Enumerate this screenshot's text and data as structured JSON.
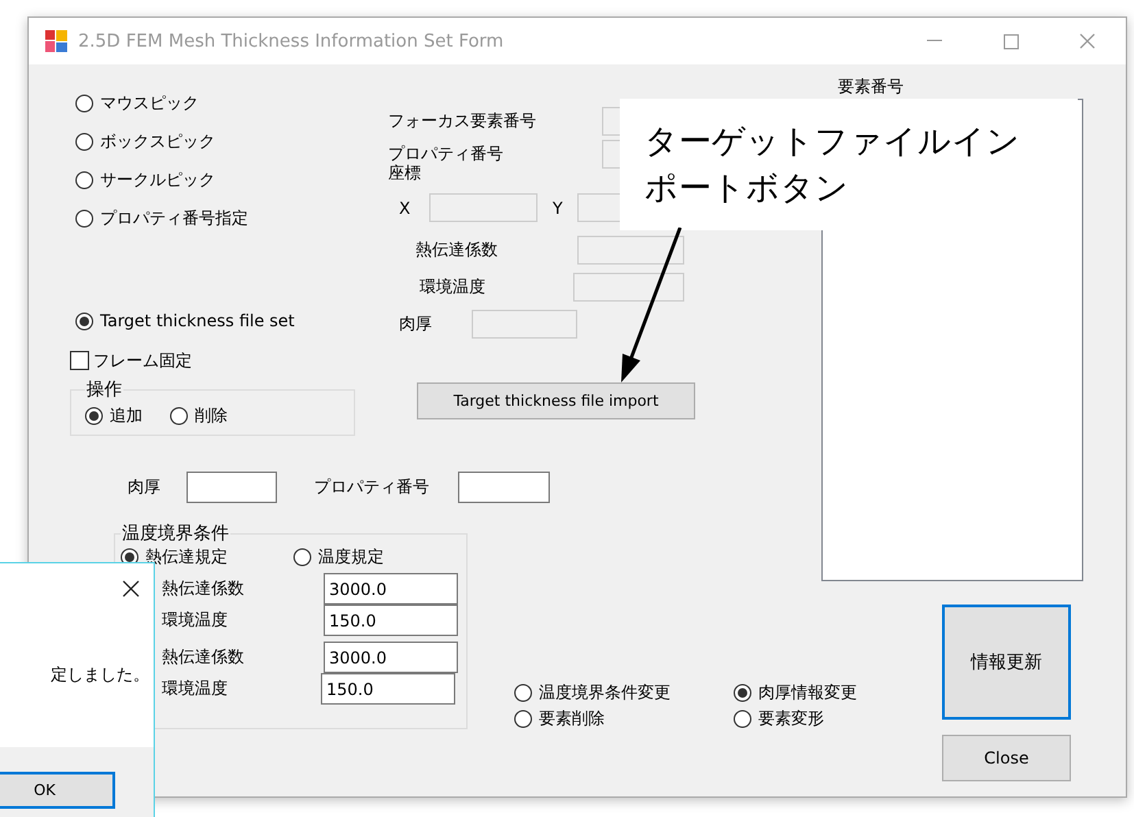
{
  "window": {
    "title": "2.5D FEM Mesh Thickness Information Set Form",
    "active": false
  },
  "pick_modes": [
    {
      "label": "マウスピック",
      "selected": false
    },
    {
      "label": "ボックスピック",
      "selected": false
    },
    {
      "label": "サークルピック",
      "selected": false
    },
    {
      "label": "プロパティ番号指定",
      "selected": false
    },
    {
      "label": "Target thickness file set",
      "selected": true
    }
  ],
  "frame_lock": {
    "label": "フレーム固定",
    "checked": false
  },
  "operation": {
    "title": "操作",
    "options": [
      {
        "label": "追加",
        "selected": true
      },
      {
        "label": "削除",
        "selected": false
      }
    ]
  },
  "info": {
    "focus_element": "フォーカス要素番号",
    "property_number": "プロパティ番号",
    "coordinates": "座標",
    "x_label": "X",
    "y_label": "Y",
    "heat_transfer": "熱伝達係数",
    "ambient_temp": "環境温度",
    "thickness": "肉厚"
  },
  "import_button": "Target thickness file import",
  "thickness_input": {
    "label": "肉厚"
  },
  "property_input": {
    "label": "プロパティ番号"
  },
  "temperature_bc": {
    "title": "温度境界条件",
    "modes": [
      {
        "label": "熱伝達規定",
        "selected": true
      },
      {
        "label": "温度規定",
        "selected": false
      }
    ],
    "rows": [
      {
        "label": "熱伝達係数",
        "value": "3000.0"
      },
      {
        "label": "環境温度",
        "value": "150.0"
      },
      {
        "label": "熱伝達係数",
        "value": "3000.0"
      },
      {
        "label": "環境温度",
        "value": "150.0"
      }
    ]
  },
  "change_modes": [
    {
      "label": "温度境界条件変更",
      "selected": false
    },
    {
      "label": "肉厚情報変更",
      "selected": true
    },
    {
      "label": "要素削除",
      "selected": false
    },
    {
      "label": "要素変形",
      "selected": false
    }
  ],
  "element_list": {
    "header": "要素番号"
  },
  "update_button": "情報更新",
  "close_button": "Close",
  "callout": {
    "text": "ターゲットファイルインポートボタン"
  },
  "dialog": {
    "message": "定しました。",
    "ok": "OK"
  }
}
